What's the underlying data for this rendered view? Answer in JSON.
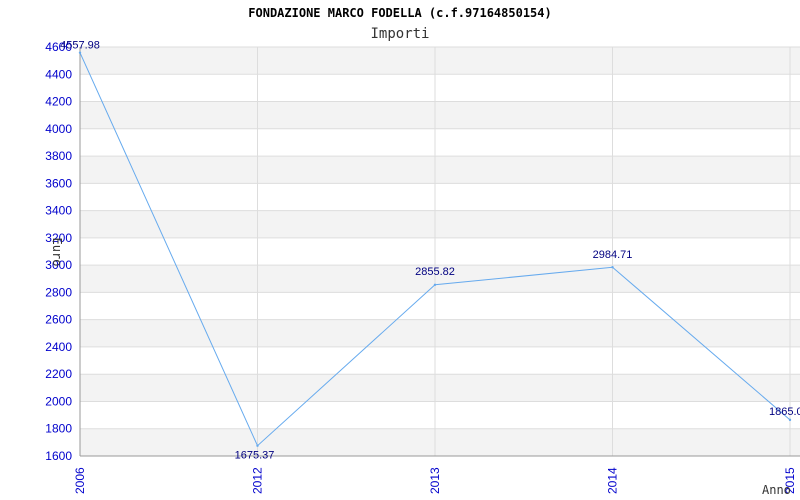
{
  "chart_data": {
    "type": "line",
    "title": "FONDAZIONE MARCO FODELLA (c.f.97164850154)",
    "subtitle": "Importi",
    "xlabel": "Anno",
    "ylabel": "Euro",
    "categories": [
      "2006",
      "2012",
      "2013",
      "2014",
      "2015"
    ],
    "series": [
      {
        "values": [
          4557.98,
          1675.37,
          2855.82,
          2984.71,
          1865.0
        ]
      }
    ],
    "data_labels": [
      "4557.98",
      "1675.37",
      "2855.82",
      "2984.71",
      "1865.0"
    ],
    "ylim": [
      1600,
      4600
    ],
    "yticks": [
      "1600",
      "1800",
      "2000",
      "2200",
      "2400",
      "2600",
      "2800",
      "3000",
      "3200",
      "3400",
      "3600",
      "3800",
      "4000",
      "4200",
      "4400",
      "4600"
    ],
    "grid": true,
    "line_color": "#66aaee",
    "band_color": "#f3f3f3",
    "tick_color": "#0000cc"
  }
}
